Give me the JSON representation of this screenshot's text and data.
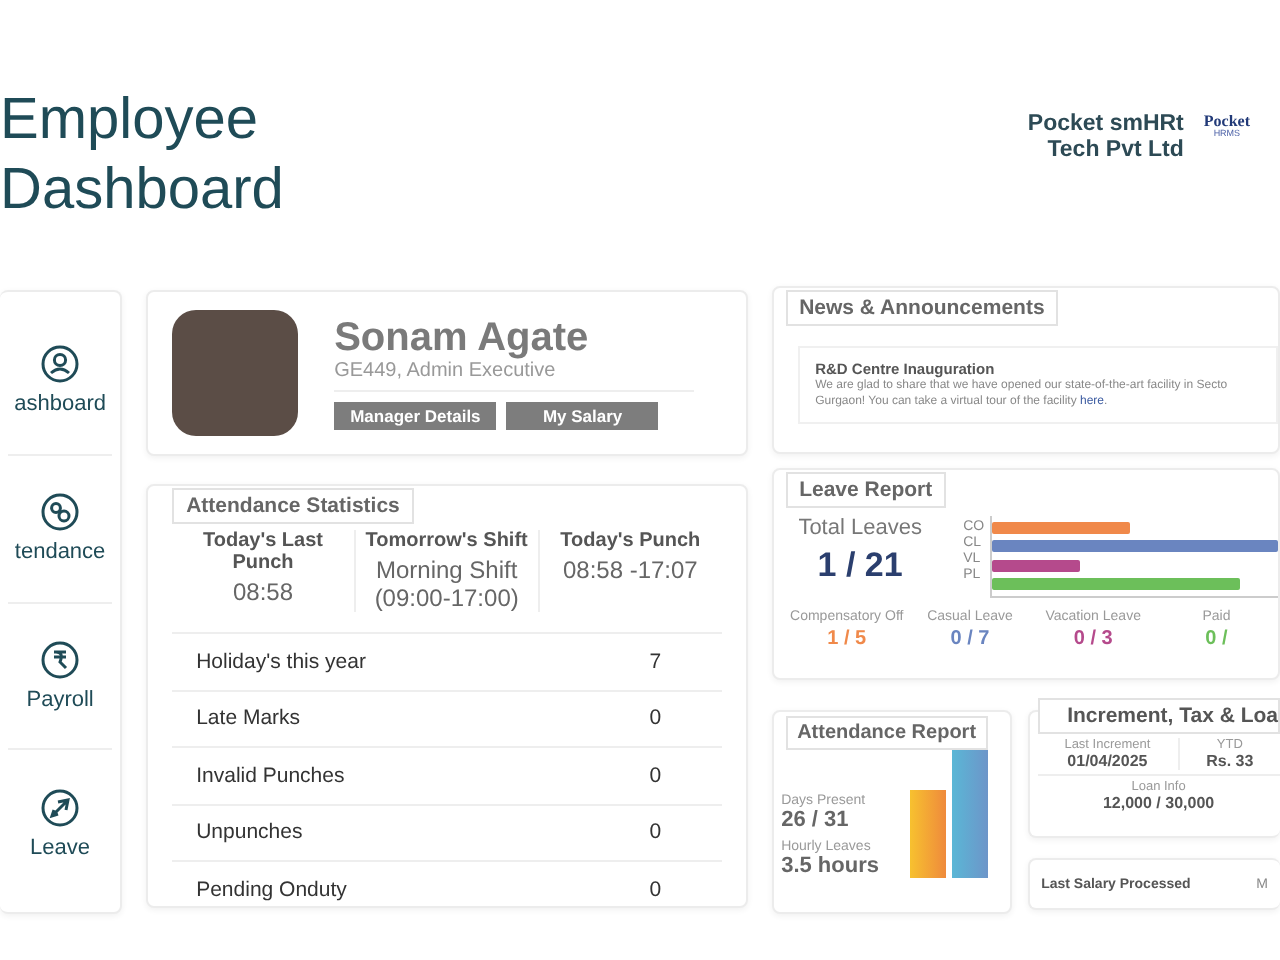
{
  "header": {
    "title_lines": [
      "Employee",
      "Dashboard"
    ],
    "company_lines": [
      "Pocket smHRt",
      "Tech Pvt Ltd"
    ],
    "logo_text": "Pocket",
    "logo_subtext": "HRMS"
  },
  "sidebar": {
    "items": [
      {
        "label": "ashboard"
      },
      {
        "label": "tendance"
      },
      {
        "label": "Payroll"
      },
      {
        "label": "Leave"
      }
    ]
  },
  "profile": {
    "name": "Sonam Agate",
    "subtitle": "GE449, Admin Executive",
    "buttons": [
      "Manager Details",
      "My Salary"
    ]
  },
  "attendance_statistics": {
    "title": "Attendance Statistics",
    "punches": [
      {
        "label": "Today's Last Punch",
        "value": "08:58"
      },
      {
        "label": "Tomorrow's Shift",
        "value": "Morning Shift (09:00-17:00)"
      },
      {
        "label": "Today's Punch",
        "value": "08:58 -17:07"
      }
    ],
    "rows": [
      {
        "label": "Holiday's this year",
        "value": "7"
      },
      {
        "label": "Late Marks",
        "value": "0"
      },
      {
        "label": "Invalid Punches",
        "value": "0"
      },
      {
        "label": "Unpunches",
        "value": "0"
      },
      {
        "label": "Pending Onduty",
        "value": "0"
      }
    ]
  },
  "news": {
    "title": "News & Announcements",
    "items": [
      {
        "title": "R&D Centre Inauguration",
        "text": "We are glad to share that we have opened our state-of-the-art facility in Secto Gurgaon! You can take a virtual tour of the facility",
        "link": "here",
        "after": "."
      }
    ]
  },
  "leave_report": {
    "title": "Leave Report",
    "total_label": "Total Leaves",
    "total": "1 / 21",
    "types": [
      {
        "code": "CO",
        "name": "Compensatory Off",
        "count": "1 / 5",
        "color": "#f0894a",
        "level": 0.48
      },
      {
        "code": "CL",
        "name": "Casual Leave",
        "count": "0 / 7",
        "color": "#6a85c0",
        "level": 1.0
      },
      {
        "code": "VL",
        "name": "Vacation Leave",
        "count": "0 / 3",
        "color": "#b54a8c",
        "level": 0.31
      },
      {
        "code": "PL",
        "name": "Paid",
        "count": "0 /",
        "color": "#6cbf5a",
        "level": 0.87
      }
    ]
  },
  "attendance_report": {
    "title": "Attendance Report",
    "stats": [
      {
        "label": "Days Present",
        "value": "26 / 31"
      },
      {
        "label": "Hourly Leaves",
        "value": "3.5 hours"
      }
    ]
  },
  "increment": {
    "title": "Increment, Tax & Loa",
    "cells": [
      {
        "label": "Last Increment",
        "value": "01/04/2025"
      },
      {
        "label": "YTD",
        "value": "Rs. 33"
      }
    ],
    "loan": {
      "label": "Loan Info",
      "value": "12,000 / 30,000"
    }
  },
  "last_salary": {
    "label": "Last Salary Processed",
    "value": "M"
  }
}
